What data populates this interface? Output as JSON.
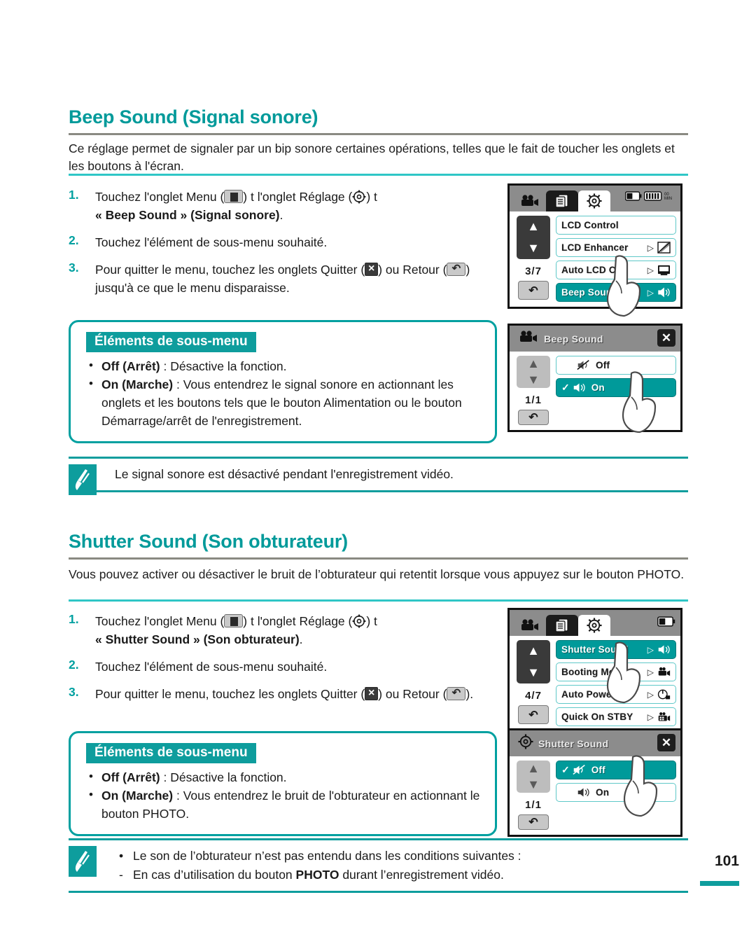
{
  "colors": {
    "teal": "#009a9a",
    "teal_light": "#2fc6c6",
    "rule_gray": "#8a8a82"
  },
  "sections": [
    {
      "id": "beep",
      "title": "Beep Sound (Signal sonore)",
      "intro": "Ce réglage permet de signaler par un bip sonore certaines opérations, telles que le fait de toucher les onglets et les boutons à l'écran.",
      "steps": [
        {
          "num": "1.",
          "pre": "Touchez l'onglet Menu (",
          "mid": ")  t  l'onglet Réglage (",
          "post": ")  t",
          "bold_line": "« Beep Sound » (Signal sonore)",
          "bold_tail": "."
        },
        {
          "num": "2.",
          "text": "Touchez l'élément de sous-menu souhaité."
        },
        {
          "num": "3.",
          "pre": "Pour quitter le menu, touchez les onglets Quitter (",
          "mid": ") ou Retour (",
          "post": ") jusqu'à ce que le menu disparaisse."
        }
      ],
      "submenu": {
        "tag": "Éléments de sous-menu",
        "items": [
          {
            "bold": "Off (Arrêt)",
            "rest": " : Désactive la fonction."
          },
          {
            "bold": "On (Marche)",
            "rest": "  : Vous entendrez le signal sonore en actionnant les onglets et les boutons tels que le bouton Alimentation ou le bouton Démarrage/arrêt de l'enregistrement."
          }
        ]
      },
      "note": "Le signal sonore est désactivé pendant l'enregistrement vidéo."
    },
    {
      "id": "shutter",
      "title": "Shutter Sound (Son obturateur)",
      "intro": "Vous pouvez activer ou désactiver le bruit de l’obturateur qui retentit lorsque vous appuyez sur le bouton PHOTO.",
      "steps": [
        {
          "num": "1.",
          "pre": "Touchez l'onglet Menu (",
          "mid": ")  t  l'onglet Réglage (",
          "post": ")  t",
          "bold_line": "« Shutter Sound » (Son obturateur)",
          "bold_tail": "."
        },
        {
          "num": "2.",
          "text": "Touchez l'élément de sous-menu souhaité."
        },
        {
          "num": "3.",
          "pre": "Pour quitter le menu, touchez les onglets Quitter (",
          "mid": ") ou Retour (",
          "post": ")."
        }
      ],
      "submenu": {
        "tag": "Éléments de sous-menu",
        "items": [
          {
            "bold": "Off (Arrêt)",
            "rest": " : Désactive la fonction."
          },
          {
            "bold": "On (Marche)",
            "rest": " : Vous entendrez le bruit de l'obturateur en actionnant le bouton PHOTO."
          }
        ]
      },
      "note_bullet": "Le son de l’obturateur n’est pas entendu dans les conditions suivantes :",
      "note_sub_pre": "En cas d’utilisation du bouton ",
      "note_sub_bold": "PHOTO",
      "note_sub_post": " durant l’enregistrement vidéo."
    }
  ],
  "screens": [
    {
      "id": "screen-beep-menu",
      "kind": "tabbed",
      "tabs": [
        "camcorder-icon",
        "playback-icon",
        "gear-icon"
      ],
      "active_tab_index": 2,
      "status_icons": [
        "battery-icon",
        "memory-icon",
        "rec-min-icon"
      ],
      "page_indicator": "3/7",
      "back_label": "return-icon",
      "rows": [
        {
          "label": "LCD Control",
          "selected": false,
          "arrow": false,
          "icon": ""
        },
        {
          "label": "LCD Enhancer",
          "selected": false,
          "arrow": true,
          "icon": "lcd-enhancer-icon"
        },
        {
          "label": "Auto LCD Off",
          "selected": false,
          "arrow": true,
          "icon": "auto-lcd-off-icon"
        },
        {
          "label": "Beep Sound",
          "selected": true,
          "arrow": true,
          "icon": "speaker-icon"
        }
      ],
      "finger_on_row": 3
    },
    {
      "id": "screen-beep-submenu",
      "kind": "titled",
      "title_icon": "camcorder-icon",
      "title": "Beep Sound",
      "close_label": "close-icon",
      "page_indicator": "1/1",
      "rows": [
        {
          "label": "Off",
          "selected": false,
          "check": false,
          "icon": "speaker-mute-icon"
        },
        {
          "label": "On",
          "selected": true,
          "check": true,
          "icon": "speaker-icon"
        }
      ],
      "finger_on_row": 1
    },
    {
      "id": "screen-shutter-menu",
      "kind": "tabbed",
      "tabs": [
        "camcorder-icon",
        "playback-icon",
        "gear-icon"
      ],
      "active_tab_index": 2,
      "status_icons": [
        "battery-icon"
      ],
      "page_indicator": "4/7",
      "back_label": "return-icon",
      "rows": [
        {
          "label": "Shutter Sound",
          "selected": true,
          "arrow": true,
          "icon": "speaker-icon"
        },
        {
          "label": "Booting Mode",
          "selected": false,
          "arrow": true,
          "icon": "booting-mode-icon"
        },
        {
          "label": "Auto Power Off",
          "selected": false,
          "arrow": true,
          "icon": "auto-power-off-icon"
        },
        {
          "label": "Quick On STBY",
          "selected": false,
          "arrow": true,
          "icon": "quick-on-stby-icon"
        }
      ],
      "finger_on_row": 0
    },
    {
      "id": "screen-shutter-submenu",
      "kind": "titled",
      "title_icon": "gear-icon",
      "title": "Shutter Sound",
      "close_label": "close-icon",
      "page_indicator": "1/1",
      "rows": [
        {
          "label": "Off",
          "selected": true,
          "check": true,
          "icon": "speaker-mute-icon"
        },
        {
          "label": "On",
          "selected": false,
          "check": false,
          "icon": "speaker-icon"
        }
      ],
      "finger_on_row": 0
    }
  ],
  "footer": {
    "page_number": "101"
  }
}
